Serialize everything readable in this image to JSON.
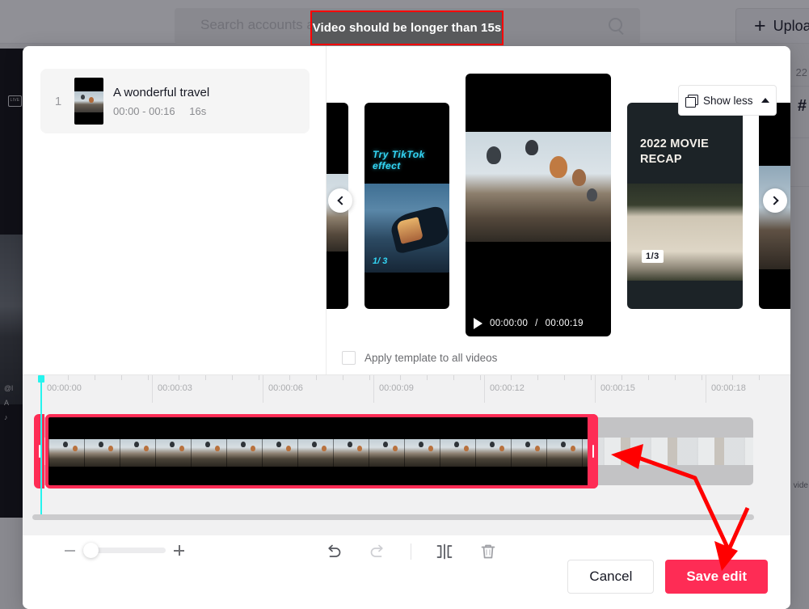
{
  "tooltip": {
    "text": "Video should be longer than 15s"
  },
  "top_bar": {
    "search": {
      "placeholder": "Search accounts and videos",
      "value": ""
    },
    "upload_button": {
      "label": "Upload",
      "plus": "+"
    }
  },
  "background": {
    "live_badge": "LIVE",
    "side_meta": [
      "@l",
      "A",
      "♪"
    ],
    "rail_number": "22",
    "rail_hash": "#",
    "rail_word": "vide"
  },
  "modal": {
    "clips": [
      {
        "index": "1",
        "title": "A wonderful travel",
        "range": "00:00 - 00:16",
        "duration": "16s"
      }
    ],
    "templates": {
      "show_less_label": "Show less",
      "items": [
        {
          "name": "template-partial-left",
          "caption": "",
          "page": ""
        },
        {
          "name": "template-try-tiktok-effect",
          "caption": "Try TikTok effect",
          "page": "1/ 3"
        },
        {
          "name": "template-balloons-preview",
          "caption": "",
          "page": ""
        },
        {
          "name": "template-2022-movie-recap",
          "caption": "2022 MOVIE RECAP",
          "page": "1/3"
        },
        {
          "name": "template-partial-right",
          "caption": "",
          "page": ""
        }
      ],
      "prev_label": "‹",
      "next_label": "›"
    },
    "player": {
      "current_time": "00:00:00",
      "separator": "/",
      "total_time": "00:00:19"
    },
    "apply_all": {
      "label": "Apply template to all videos",
      "checked": false
    },
    "timeline": {
      "ruler_labels": [
        "00:00:00",
        "00:00:03",
        "00:00:06",
        "00:00:09",
        "00:00:12",
        "00:00:15",
        "00:00:18"
      ],
      "playhead_time": "00:00:00"
    },
    "toolbar": {
      "zoom_minus": "−",
      "zoom_plus": "+",
      "undo_label": "Undo",
      "redo_label": "Redo",
      "split_label": "Split",
      "delete_label": "Delete"
    },
    "actions": {
      "cancel_label": "Cancel",
      "save_label": "Save edit"
    }
  },
  "colors": {
    "accent_red": "#FE2C55",
    "accent_cyan": "#25F4EE",
    "annotation_red": "#FF0000",
    "tooltip_bg": "#58595B"
  }
}
